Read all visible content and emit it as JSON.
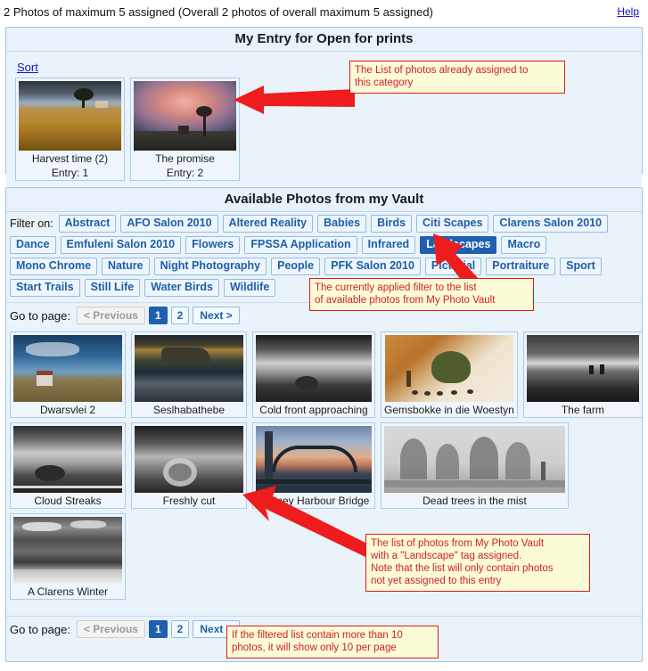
{
  "header": {
    "status": "2 Photos of maximum 5 assigned (Overall 2 photos of overall maximum 5 assigned)",
    "help_label": "Help"
  },
  "entry_panel": {
    "title": "My Entry for Open for prints",
    "sort_label": "Sort",
    "photos": [
      {
        "title": "Harvest time (2)",
        "entry": "Entry: 1"
      },
      {
        "title": "The promise",
        "entry": "Entry: 2"
      }
    ]
  },
  "vault_panel": {
    "title": "Available Photos from my Vault",
    "filter_label": "Filter on:",
    "tags_row1": [
      "Abstract",
      "AFO Salon 2010",
      "Altered Reality",
      "Babies",
      "Birds",
      "Citi Scapes",
      "Clarens Salon 2010"
    ],
    "tags_row2": [
      "Dance",
      "Emfuleni Salon 2010",
      "Flowers",
      "FPSSA Application",
      "Infrared",
      "Landscapes",
      "Macro"
    ],
    "tags_row3": [
      "Mono Chrome",
      "Nature",
      "Night Photography",
      "People",
      "PFK Salon 2010",
      "Pictorial",
      "Portraiture",
      "Sport"
    ],
    "tags_row4": [
      "Start Trails",
      "Still Life",
      "Water Birds",
      "Wildlife"
    ],
    "selected_tag": "Landscapes",
    "pager": {
      "label": "Go to page:",
      "previous": "< Previous",
      "pages": [
        "1",
        "2"
      ],
      "current_page": "1",
      "next": "Next >"
    },
    "photos_row1": [
      "Dwarsvlei 2",
      "Seslhabathebe",
      "Cold front approaching",
      "Gemsbokke in die Woestyn",
      "The farm"
    ],
    "photos_row2": [
      "Cloud Streaks",
      "Freshly cut",
      "Sydney Harbour Bridge",
      "Dead trees in the mist"
    ],
    "photos_row3": [
      "A Clarens Winter"
    ]
  },
  "annotations": {
    "assigned_list": "The List of photos already assigned to\nthis category",
    "applied_filter": "The currently applied filter to the list\nof available photos from My Photo Vault",
    "vault_list": "The list of photos from My Photo Vault\nwith a \"Landscape\" tag assigned.\nNote that the list will only contain photos\nnot yet assigned to this entry",
    "pagination_note": "If the filtered list contain more than 10\nphotos, it will show only 10 per page"
  },
  "colors": {
    "accent": "#1f5fb0",
    "panel_bg": "#eaf2fa",
    "panel_border": "#9dc3e6",
    "callout_bg": "#fbfbd8",
    "callout_border": "#e01b1b",
    "callout_text": "#d42121",
    "link": "#1414cc"
  }
}
